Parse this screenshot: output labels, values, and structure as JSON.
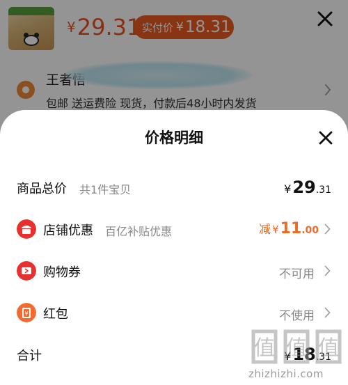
{
  "product": {
    "price_currency": "¥",
    "price": "29.31",
    "pay_label": "实付价",
    "pay_currency": "¥",
    "pay_price": "18.31"
  },
  "address": {
    "name": "王者悟",
    "shipping_note": "包邮  送运费险  现货，付款后48小时内发货"
  },
  "sheet": {
    "title": "价格明细",
    "rows": [
      {
        "label": "商品总价",
        "sub": "共1件宝贝",
        "currency": "¥",
        "int": "29",
        "dec": ".31"
      },
      {
        "label": "店铺优惠",
        "sub": "百亿补贴优惠",
        "prefix": "减",
        "currency": "¥",
        "int": "11",
        "dec": ".00",
        "icon": "store-icon"
      },
      {
        "label": "购物券",
        "value": "不可用",
        "icon": "coupon-icon"
      },
      {
        "label": "红包",
        "value": "不使用",
        "icon": "red-packet-icon"
      },
      {
        "label": "合计",
        "currency": "¥",
        "int": "18",
        "dec": ".31"
      }
    ]
  },
  "watermark": {
    "brand": "值",
    "site": "zhizhizhi.com"
  },
  "colors": {
    "accent": "#ec5a21",
    "discount": "#f06a24",
    "icon_red": "#e8312f",
    "muted": "#888888"
  }
}
